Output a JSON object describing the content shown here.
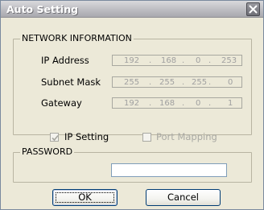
{
  "window": {
    "title": "Auto Setting"
  },
  "network": {
    "legend": "NETWORK INFORMATION",
    "ip_label": "IP Address",
    "subnet_label": "Subnet Mask",
    "gateway_label": "Gateway",
    "ip": [
      "192",
      "168",
      "0",
      "253"
    ],
    "subnet": [
      "255",
      "255",
      "255",
      "0"
    ],
    "gateway": [
      "192",
      "168",
      "0",
      "1"
    ]
  },
  "options": {
    "ip_setting_label": "IP Setting",
    "ip_setting_checked": true,
    "port_mapping_label": "Port Mapping",
    "port_mapping_checked": false
  },
  "password": {
    "legend": "PASSWORD",
    "value": ""
  },
  "buttons": {
    "ok": "OK",
    "cancel": "Cancel"
  },
  "icons": {
    "close": "close-icon",
    "check": "check-icon"
  }
}
